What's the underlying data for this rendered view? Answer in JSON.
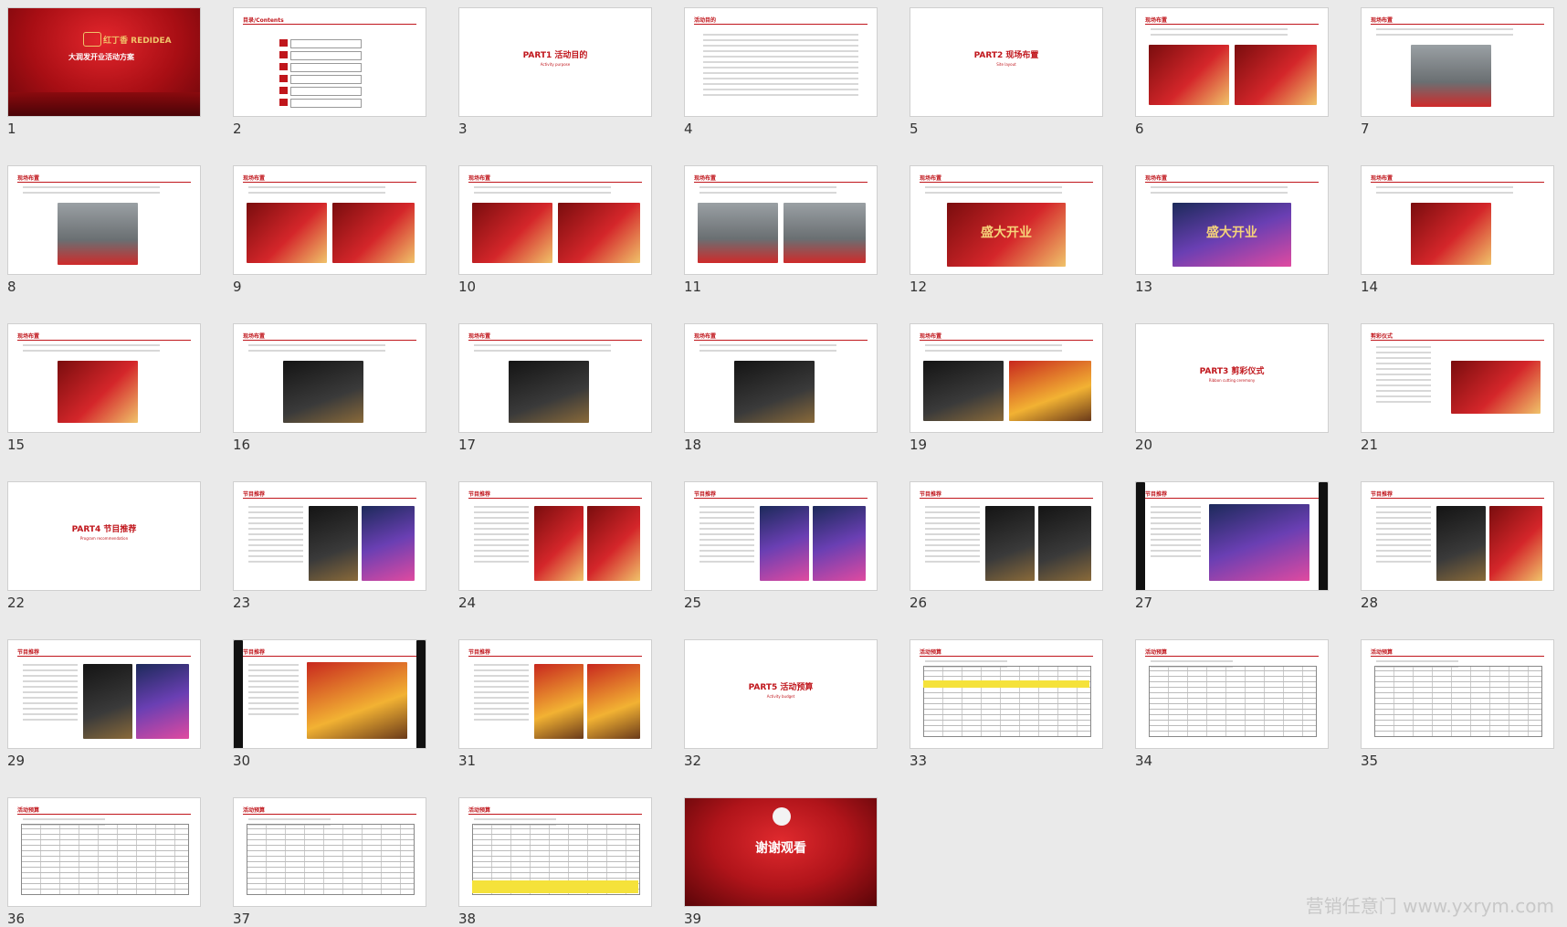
{
  "slides": [
    {
      "n": "1",
      "kind": "cover",
      "title": "大润发开业活动方案",
      "brand": "红丁香 REDIDEA"
    },
    {
      "n": "2",
      "kind": "toc",
      "title": "目录/Contents"
    },
    {
      "n": "3",
      "kind": "section",
      "text": "PART1  活动目的",
      "sub": "Activity purpose"
    },
    {
      "n": "4",
      "kind": "text",
      "title": "活动目的"
    },
    {
      "n": "5",
      "kind": "section",
      "text": "PART2  现场布置",
      "sub": "Site layout"
    },
    {
      "n": "6",
      "kind": "photo2",
      "title": "现场布置",
      "p1": "redph",
      "p2": "redph"
    },
    {
      "n": "7",
      "kind": "photo1",
      "title": "现场布置",
      "p1": "hallph"
    },
    {
      "n": "8",
      "kind": "photo1",
      "title": "现场布置",
      "p1": "hallph"
    },
    {
      "n": "9",
      "kind": "photo2",
      "title": "现场布置",
      "p1": "redph",
      "p2": "redph"
    },
    {
      "n": "10",
      "kind": "photo2",
      "title": "现场布置",
      "p1": "redph",
      "p2": "redph"
    },
    {
      "n": "11",
      "kind": "photo2",
      "title": "现场布置",
      "p1": "hallph",
      "p2": "hallph"
    },
    {
      "n": "12",
      "kind": "banner",
      "title": "现场布置",
      "p1": "redph",
      "banner": "盛大开业"
    },
    {
      "n": "13",
      "kind": "banner",
      "title": "现场布置",
      "p1": "stageph",
      "banner": "盛大开业"
    },
    {
      "n": "14",
      "kind": "photo1",
      "title": "现场布置",
      "p1": "redph"
    },
    {
      "n": "15",
      "kind": "photo1",
      "title": "现场布置",
      "p1": "redph"
    },
    {
      "n": "16",
      "kind": "photo1",
      "title": "现场布置",
      "p1": "darkph"
    },
    {
      "n": "17",
      "kind": "photo1",
      "title": "现场布置",
      "p1": "darkph"
    },
    {
      "n": "18",
      "kind": "photo1",
      "title": "现场布置",
      "p1": "darkph"
    },
    {
      "n": "19",
      "kind": "photo2",
      "title": "现场布置",
      "p1": "darkph",
      "p2": "lionph"
    },
    {
      "n": "20",
      "kind": "section",
      "text": "PART3  剪彩仪式",
      "sub": "Ribbon cutting ceremony"
    },
    {
      "n": "21",
      "kind": "photo1r",
      "title": "剪彩仪式",
      "p1": "redph"
    },
    {
      "n": "22",
      "kind": "section",
      "text": "PART4  节目推荐",
      "sub": "Program recommendation"
    },
    {
      "n": "23",
      "kind": "photo2r",
      "title": "节目推荐",
      "p1": "darkph",
      "p2": "stageph"
    },
    {
      "n": "24",
      "kind": "photo2r",
      "title": "节目推荐",
      "p1": "redph",
      "p2": "redph"
    },
    {
      "n": "25",
      "kind": "photo2r",
      "title": "节目推荐",
      "p1": "stageph",
      "p2": "stageph"
    },
    {
      "n": "26",
      "kind": "photo2r",
      "title": "节目推荐",
      "p1": "darkph",
      "p2": "darkph"
    },
    {
      "n": "27",
      "kind": "dark",
      "title": "节目推荐",
      "p1": "stageph"
    },
    {
      "n": "28",
      "kind": "photo2r",
      "title": "节目推荐",
      "p1": "darkph",
      "p2": "redph"
    },
    {
      "n": "29",
      "kind": "photo2r",
      "title": "节目推荐",
      "p1": "darkph",
      "p2": "stageph"
    },
    {
      "n": "30",
      "kind": "dark",
      "title": "节目推荐",
      "p1": "lionph"
    },
    {
      "n": "31",
      "kind": "photo2r",
      "title": "节目推荐",
      "p1": "lionph",
      "p2": "lionph"
    },
    {
      "n": "32",
      "kind": "section",
      "text": "PART5  活动预算",
      "sub": "Activity budget"
    },
    {
      "n": "33",
      "kind": "table",
      "title": "活动预算",
      "yellow": "top"
    },
    {
      "n": "34",
      "kind": "table",
      "title": "活动预算",
      "yellow": "none"
    },
    {
      "n": "35",
      "kind": "table",
      "title": "活动预算",
      "yellow": "none"
    },
    {
      "n": "36",
      "kind": "table",
      "title": "活动预算",
      "yellow": "none"
    },
    {
      "n": "37",
      "kind": "table",
      "title": "活动预算",
      "yellow": "none"
    },
    {
      "n": "38",
      "kind": "table",
      "title": "活动预算",
      "yellow": "bottom"
    },
    {
      "n": "39",
      "kind": "thanks",
      "text": "谢谢观看"
    }
  ],
  "watermark": "营销任意门 www.yxrym.com"
}
